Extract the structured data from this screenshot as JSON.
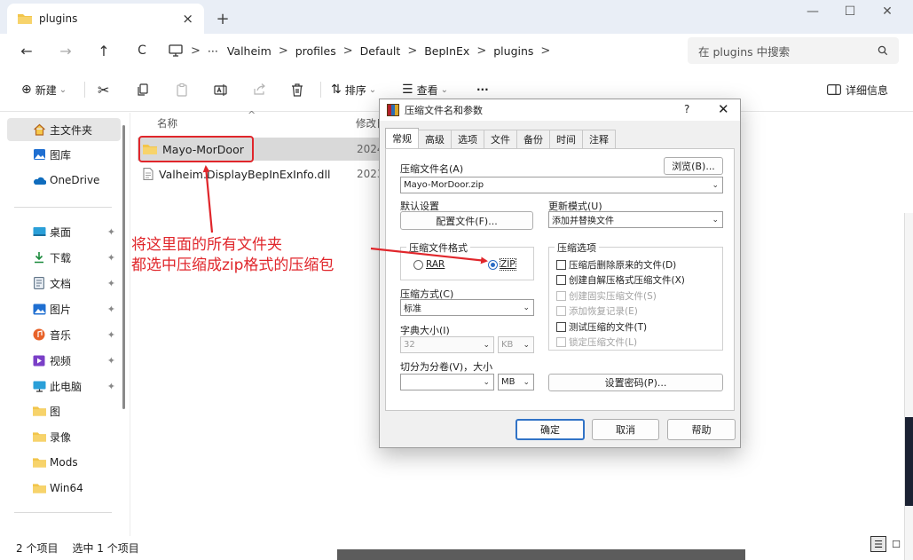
{
  "window": {
    "tab_title": "plugins",
    "tab_close": "×",
    "new_tab": "+",
    "minimize": "—",
    "maximize": "☐",
    "close": "✕"
  },
  "nav": {
    "back": "←",
    "forward": "→",
    "up": "↑",
    "refresh": "C",
    "more": "···",
    "breadcrumbs": [
      "Valheim",
      "profiles",
      "Default",
      "BepInEx",
      "plugins"
    ],
    "sep": ">",
    "search_placeholder": "在 plugins 中搜索"
  },
  "toolbar": {
    "new_label": "新建",
    "sort_label": "排序",
    "view_label": "查看",
    "more_label": "···",
    "details_label": "详细信息",
    "dropdown": "⌄"
  },
  "sidebar": {
    "top": [
      {
        "label": "主文件夹",
        "icon": "home-icon"
      },
      {
        "label": "图库",
        "icon": "gallery-icon"
      },
      {
        "label": "OneDrive",
        "icon": "onedrive-icon"
      }
    ],
    "pinned": [
      {
        "label": "桌面",
        "icon": "desktop-icon"
      },
      {
        "label": "下载",
        "icon": "download-icon"
      },
      {
        "label": "文档",
        "icon": "documents-icon"
      },
      {
        "label": "图片",
        "icon": "pictures-icon"
      },
      {
        "label": "音乐",
        "icon": "music-icon"
      },
      {
        "label": "视频",
        "icon": "video-icon"
      },
      {
        "label": "此电脑",
        "icon": "this-pc-icon"
      },
      {
        "label": "图",
        "icon": "folder-icon"
      },
      {
        "label": "录像",
        "icon": "folder-icon"
      },
      {
        "label": "Mods",
        "icon": "folder-icon"
      },
      {
        "label": "Win64",
        "icon": "folder-icon"
      }
    ]
  },
  "content": {
    "col_name": "名称",
    "col_modified": "修改日",
    "files": [
      {
        "name": "Mayo-MorDoor",
        "date": "2024",
        "type": "folder"
      },
      {
        "name": "Valheim.DisplayBepInExInfo.dll",
        "date": "2023",
        "type": "file"
      }
    ]
  },
  "annotation": {
    "line1": "将这里面的所有文件夹",
    "line2": "都选中压缩成zip格式的压缩包"
  },
  "status": {
    "items": "2 个项目",
    "selected": "选中 1 个项目"
  },
  "dialog": {
    "title": "压缩文件名和参数",
    "help": "?",
    "close": "✕",
    "tabs": [
      "常规",
      "高级",
      "选项",
      "文件",
      "备份",
      "时间",
      "注释"
    ],
    "archive_name_label": "压缩文件名(A)",
    "archive_name_value": "Mayo-MorDoor.zip",
    "browse_label": "浏览(B)...",
    "default_profile_label": "默认设置",
    "profiles_button": "配置文件(F)...",
    "update_mode_label": "更新模式(U)",
    "update_mode_value": "添加并替换文件",
    "format_group": "压缩文件格式",
    "format_rar": "RAR",
    "format_zip": "ZIP",
    "options_group": "压缩选项",
    "options": [
      {
        "label": "压缩后删除原来的文件(D)",
        "enabled": true
      },
      {
        "label": "创建自解压格式压缩文件(X)",
        "enabled": true
      },
      {
        "label": "创建固实压缩文件(S)",
        "enabled": false
      },
      {
        "label": "添加恢复记录(E)",
        "enabled": false
      },
      {
        "label": "测试压缩的文件(T)",
        "enabled": true
      },
      {
        "label": "锁定压缩文件(L)",
        "enabled": false
      }
    ],
    "method_label": "压缩方式(C)",
    "method_value": "标准",
    "dict_label": "字典大小(I)",
    "dict_value": "32",
    "dict_unit": "KB",
    "split_label": "切分为分卷(V)，大小",
    "split_unit": "MB",
    "password_button": "设置密码(P)...",
    "ok": "确定",
    "cancel": "取消",
    "help_button": "帮助"
  },
  "colors": {
    "annotation_red": "#e0262b",
    "accent_blue": "#2b6cc4",
    "folder_yellow": "#f2c54b"
  }
}
